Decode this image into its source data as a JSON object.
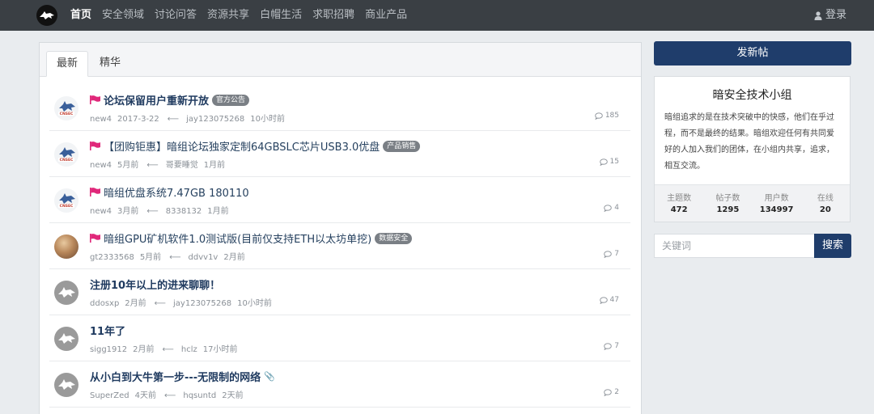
{
  "nav": {
    "logo_icon": "wolf-logo-icon",
    "items": [
      "首页",
      "安全领域",
      "讨论问答",
      "资源共享",
      "白帽生活",
      "求职招聘",
      "商业产品"
    ],
    "login_label": "登录"
  },
  "tabs": [
    "最新",
    "精华"
  ],
  "threads": [
    {
      "avatar": "cnsec",
      "pinned": true,
      "title": "论坛保留用户重新开放",
      "bold": true,
      "tag": "官方公告",
      "author": "new4",
      "time": "2017-3-22",
      "last_user": "jay123075268",
      "last_time": "10小时前",
      "replies": "185"
    },
    {
      "avatar": "cnsec",
      "pinned": true,
      "title": "【团购钜惠】暗组论坛独家定制64GBSLC芯片USB3.0优盘",
      "bold": false,
      "tag": "产品销售",
      "author": "new4",
      "time": "5月前",
      "last_user": "哥要睡觉",
      "last_time": "1月前",
      "replies": "15"
    },
    {
      "avatar": "cnsec",
      "pinned": true,
      "title": "暗组优盘系统7.47GB 180110",
      "bold": false,
      "tag": "",
      "author": "new4",
      "time": "3月前",
      "last_user": "8338132",
      "last_time": "1月前",
      "replies": "4"
    },
    {
      "avatar": "photo",
      "pinned": true,
      "title": "暗组GPU矿机软件1.0测试版(目前仅支持ETH以太坊单挖)",
      "bold": false,
      "tag": "数据安全",
      "author": "gt2333568",
      "time": "5月前",
      "last_user": "ddvv1v",
      "last_time": "2月前",
      "replies": "7"
    },
    {
      "avatar": "gray",
      "pinned": false,
      "title": "注册10年以上的进来聊聊！",
      "bold": true,
      "tag": "",
      "author": "ddosxp",
      "time": "2月前",
      "last_user": "jay123075268",
      "last_time": "10小时前",
      "replies": "47"
    },
    {
      "avatar": "gray",
      "pinned": false,
      "title": "11年了",
      "bold": true,
      "tag": "",
      "author": "sigg1912",
      "time": "2月前",
      "last_user": "hclz",
      "last_time": "17小时前",
      "replies": "7"
    },
    {
      "avatar": "gray",
      "pinned": false,
      "title": "从小白到大牛第一步---无限制的网络",
      "bold": true,
      "tag": "",
      "attachment": true,
      "author": "SuperZed",
      "time": "4天前",
      "last_user": "hqsuntd",
      "last_time": "2天前",
      "replies": "2"
    }
  ],
  "sidebar": {
    "post_button": "发新帖",
    "group_title": "暗安全技术小组",
    "group_desc": "暗组追求的是在技术突破中的快感，他们在乎过程，而不是最终的结果。暗组欢迎任何有共同爱好的人加入我们的团体，在小组内共享，追求，相互交流。",
    "stats": [
      {
        "label": "主题数",
        "value": "472"
      },
      {
        "label": "帖子数",
        "value": "1295"
      },
      {
        "label": "用户数",
        "value": "134997"
      },
      {
        "label": "在线",
        "value": "20"
      }
    ],
    "search_placeholder": "关键词",
    "search_button": "搜索"
  },
  "colors": {
    "navbar": "#3a3f44",
    "accent": "#1f3d6b",
    "flag": "#e0287a"
  }
}
